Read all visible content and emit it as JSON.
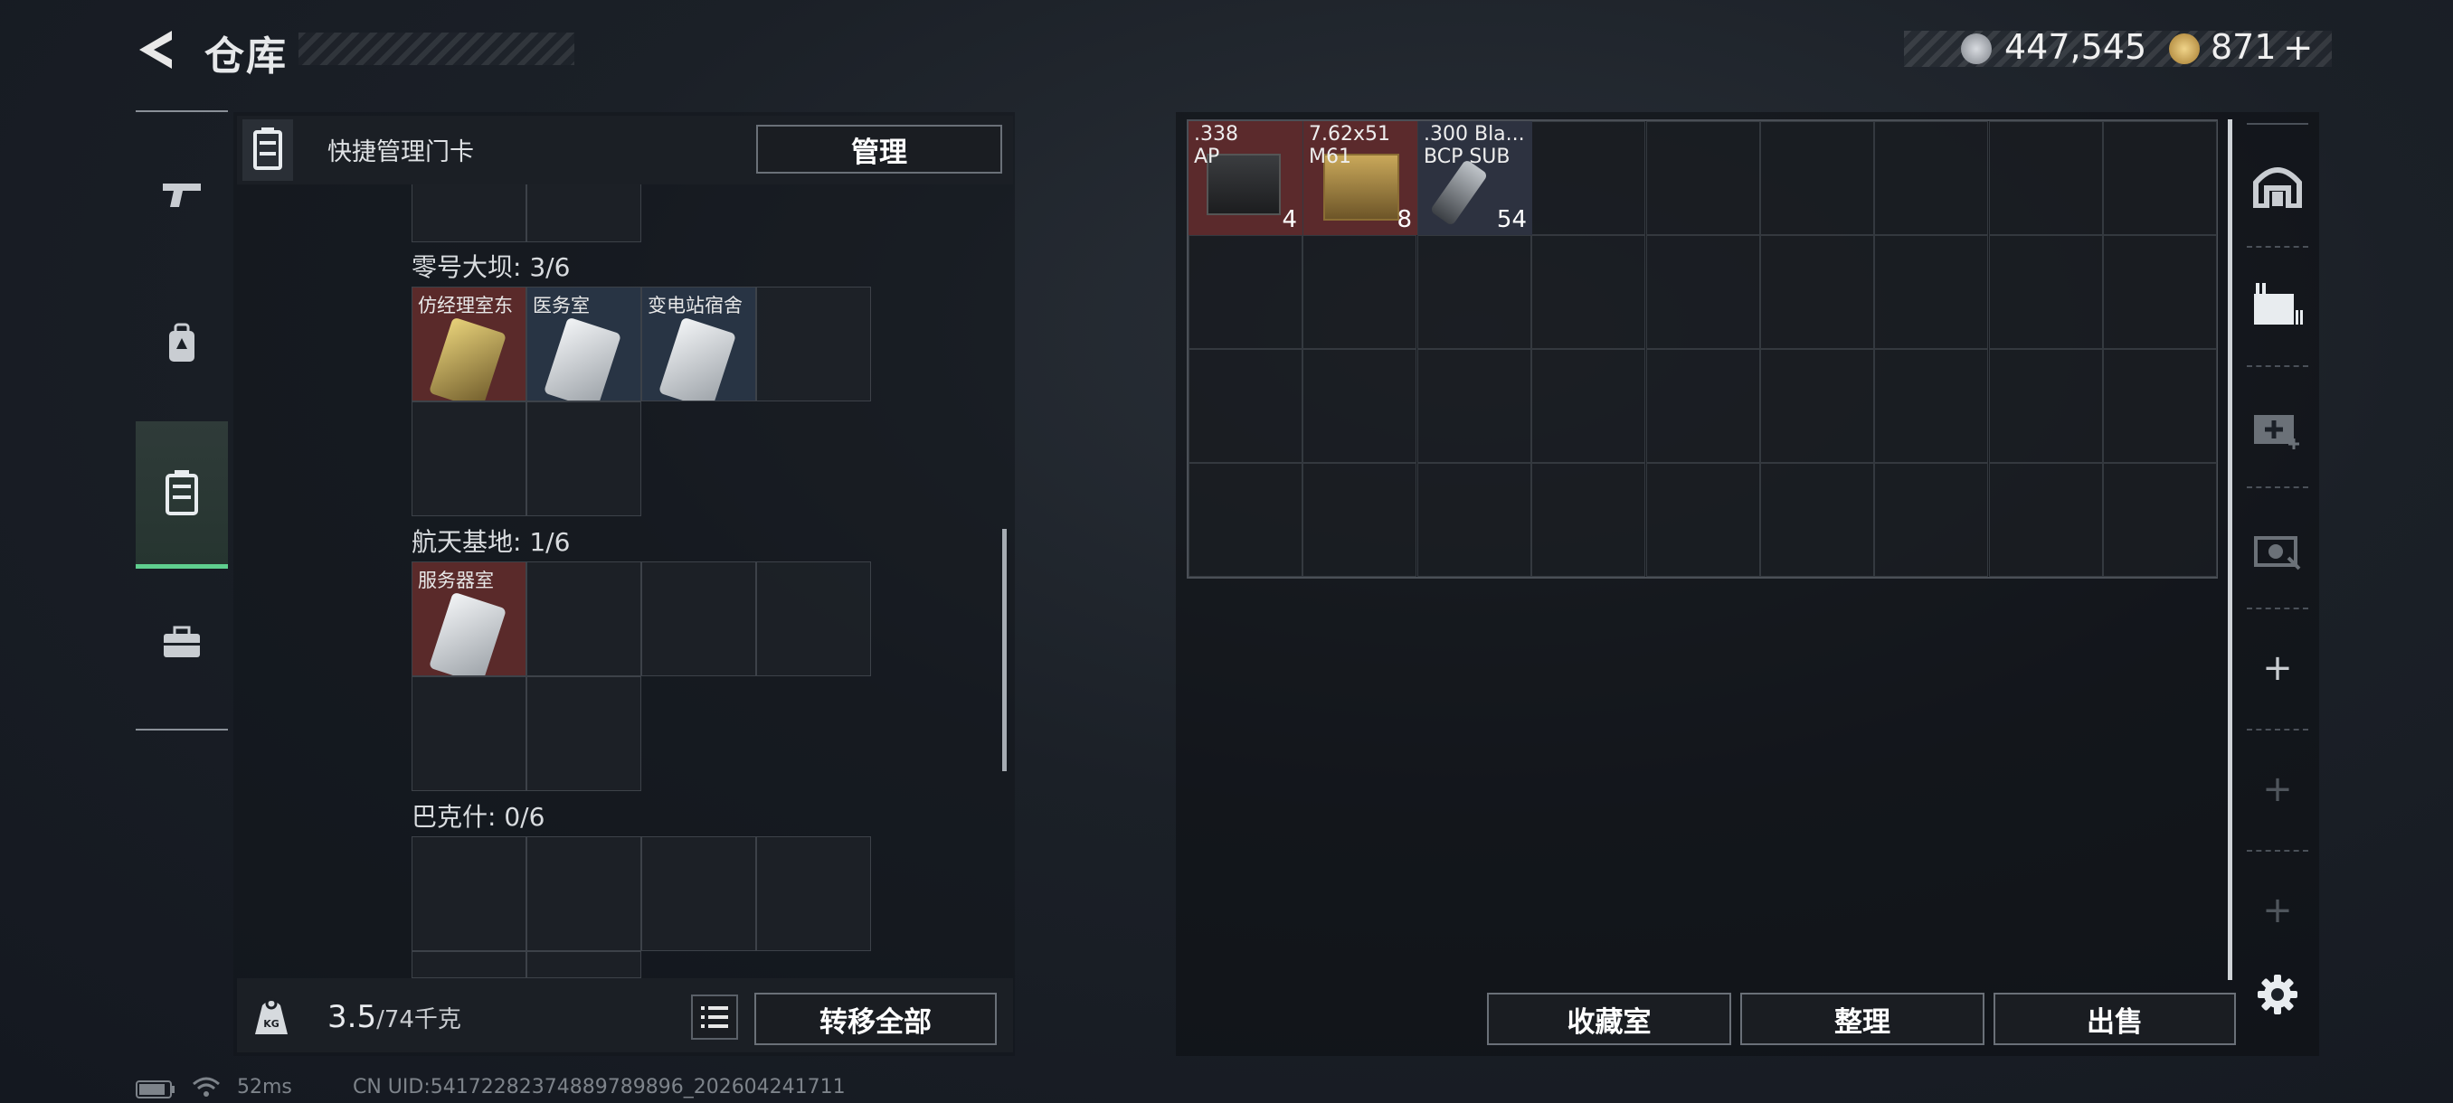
{
  "header": {
    "title": "仓库",
    "currency_silver": "447,545",
    "currency_gold": "871",
    "currency_add": "+"
  },
  "left_panel": {
    "header_label": "快捷管理门卡",
    "manage_button": "管理",
    "sections": [
      {
        "name": "零号大坝: 3/6",
        "cards": [
          "仿经理室东",
          "医务室",
          "变电站宿舍"
        ]
      },
      {
        "name": "航天基地: 1/6",
        "cards": [
          "服务器室"
        ]
      },
      {
        "name": "巴克什: 0/6",
        "cards": []
      }
    ],
    "weight_current": "3.5",
    "weight_max": "/74千克",
    "transfer_all_button": "转移全部"
  },
  "stash": {
    "items": [
      {
        "name": ".338\nAP",
        "count": "4",
        "color": "#5b2a2c"
      },
      {
        "name": "7.62x51\nM61",
        "count": "8",
        "color": "#5b2a2c"
      },
      {
        "name": ".300 Bla...\nBCP SUB",
        "count": "54",
        "color": "#2d3240"
      }
    ],
    "buttons": {
      "collection": "收藏室",
      "sort": "整理",
      "sell": "出售"
    }
  },
  "status_bar": {
    "ping": "52ms",
    "uid": "CN UID:54172282374889789896_202604241711"
  }
}
